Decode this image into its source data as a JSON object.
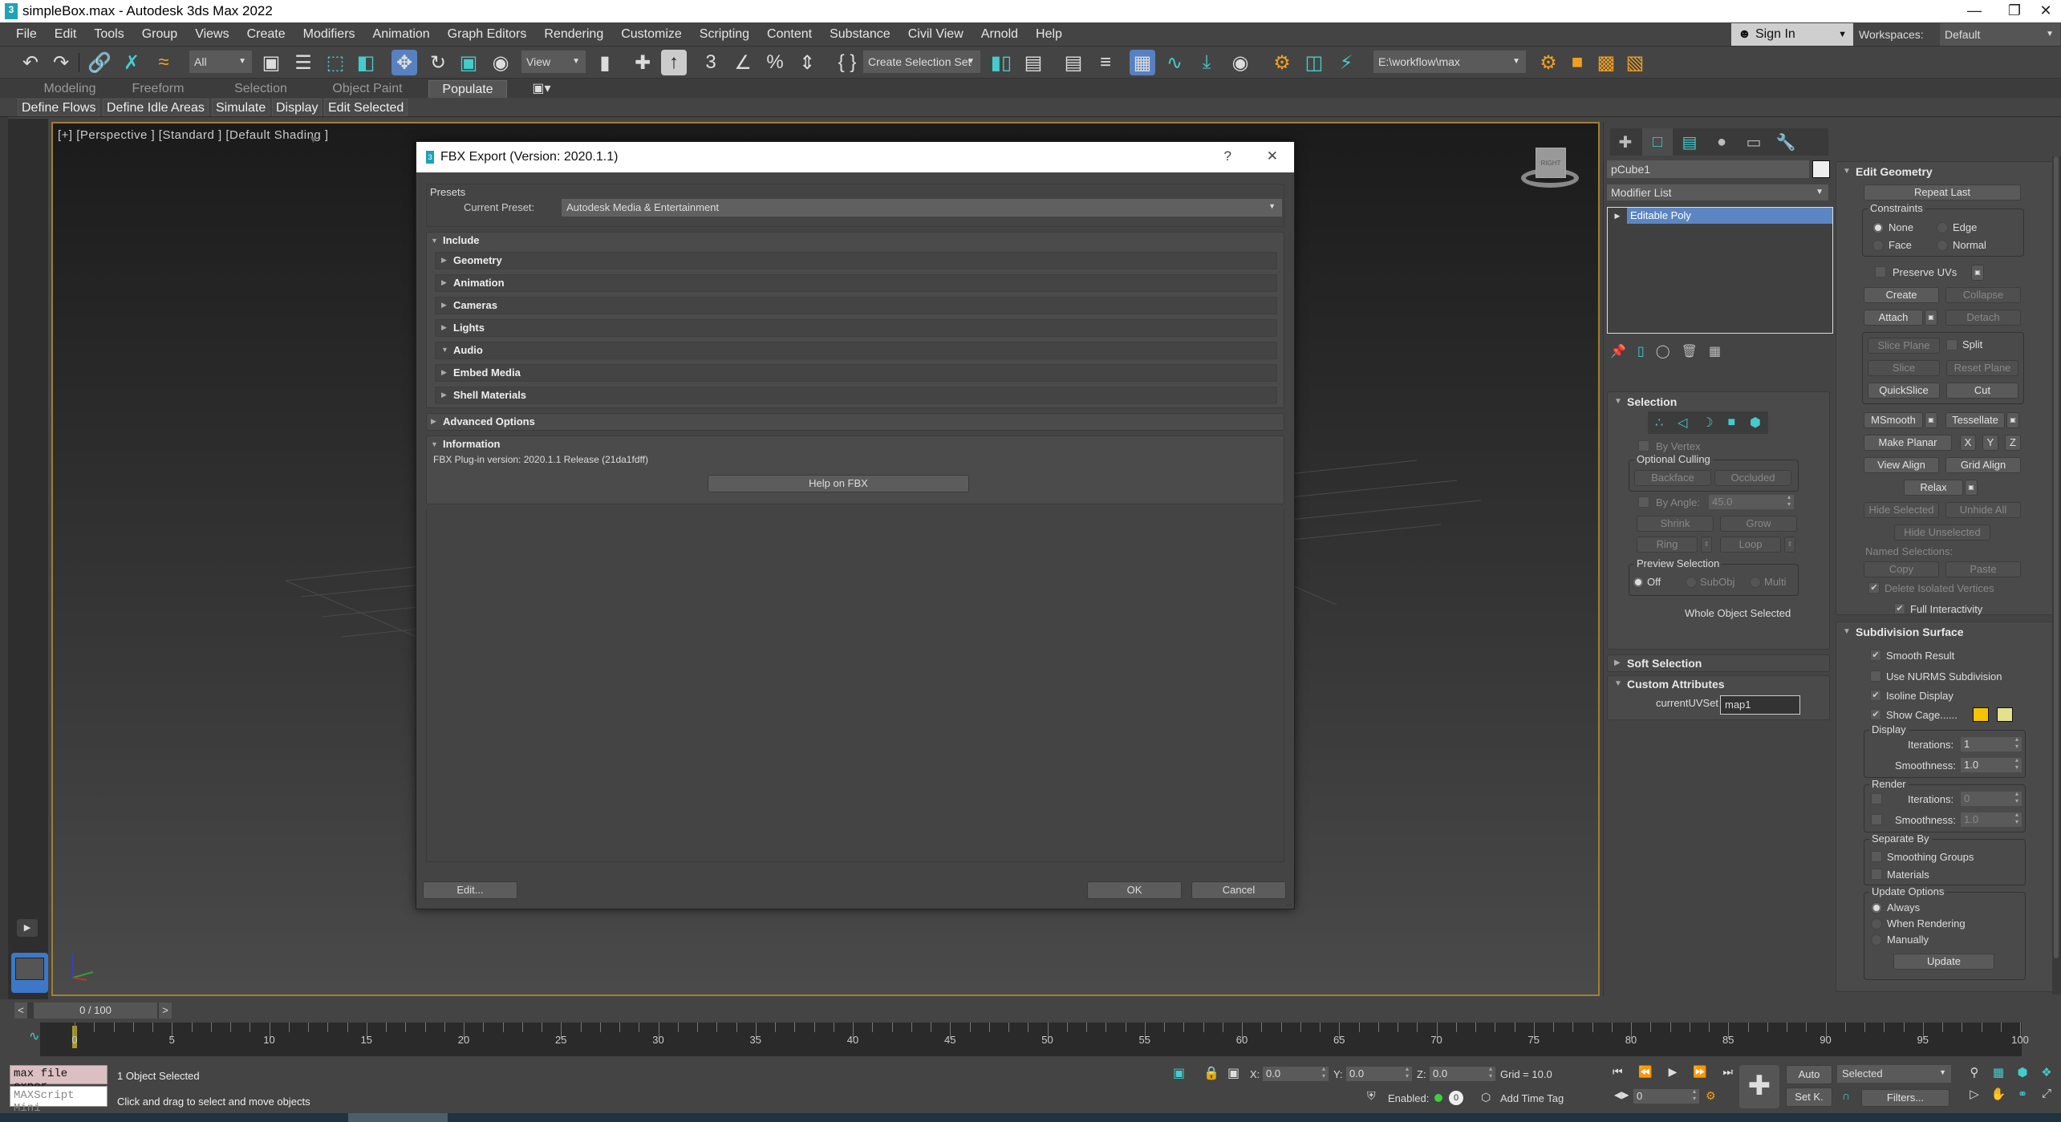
{
  "window": {
    "title": "simpleBox.max - Autodesk 3ds Max 2022",
    "app_icon": "3",
    "minimize": "—",
    "maximize": "❐",
    "close": "✕"
  },
  "menu": [
    "File",
    "Edit",
    "Tools",
    "Group",
    "Views",
    "Create",
    "Modifiers",
    "Animation",
    "Graph Editors",
    "Rendering",
    "Customize",
    "Scripting",
    "Content",
    "Substance",
    "Civil View",
    "Arnold",
    "Help"
  ],
  "account": {
    "sign_in": "Sign In",
    "workspaces_label": "Workspaces:",
    "workspace": "Default"
  },
  "toolbar": {
    "selection_filter": "All",
    "ref_coord": "View",
    "named_selection": "Create Selection Set",
    "project_path": "E:\\workflow\\max"
  },
  "ribbon": {
    "tabs": [
      "Modeling",
      "Freeform",
      "Selection",
      "Object Paint",
      "Populate"
    ],
    "active_tab": "Populate",
    "buttons": [
      "Define Flows",
      "Define Idle Areas",
      "Simulate",
      "Display",
      "Edit Selected"
    ]
  },
  "viewport": {
    "label": "[+] [Perspective ] [Standard ] [Default Shading ]",
    "viewcube_face": "RIGHT"
  },
  "dialog": {
    "title": "FBX Export (Version: 2020.1.1)",
    "help": "?",
    "close": "✕",
    "presets_label": "Presets",
    "current_preset_label": "Current Preset:",
    "current_preset": "Autodesk Media & Entertainment",
    "include_label": "Include",
    "include_items": [
      {
        "label": "Geometry",
        "expanded": false
      },
      {
        "label": "Animation",
        "expanded": false
      },
      {
        "label": "Cameras",
        "expanded": false
      },
      {
        "label": "Lights",
        "expanded": false
      },
      {
        "label": "Audio",
        "expanded": true
      },
      {
        "label": "Embed Media",
        "expanded": false
      },
      {
        "label": "Shell Materials",
        "expanded": false
      }
    ],
    "advanced_label": "Advanced Options",
    "information_label": "Information",
    "plugin_version": "FBX Plug-in version: 2020.1.1 Release (21da1fdff)",
    "help_button": "Help on FBX",
    "edit_button": "Edit...",
    "ok_button": "OK",
    "cancel_button": "Cancel"
  },
  "command_panel": {
    "object_name": "pCube1",
    "modifier_list": "Modifier List",
    "stack": [
      "Editable Poly"
    ],
    "selection": {
      "title": "Selection",
      "by_vertex": "By Vertex",
      "optional_culling": "Optional Culling",
      "backface": "Backface",
      "occluded": "Occluded",
      "by_angle": "By Angle:",
      "angle_value": "45.0",
      "shrink": "Shrink",
      "grow": "Grow",
      "ring": "Ring",
      "loop": "Loop",
      "preview_selection": "Preview Selection",
      "preview_off": "Off",
      "preview_subobj": "SubObj",
      "preview_multi": "Multi",
      "status": "Whole Object Selected"
    },
    "soft_selection": "Soft Selection",
    "custom_attributes": {
      "title": "Custom Attributes",
      "label": "currentUVSet",
      "value": "map1"
    },
    "edit_geometry": {
      "title": "Edit Geometry",
      "repeat_last": "Repeat Last",
      "constraints": "Constraints",
      "none": "None",
      "edge": "Edge",
      "face": "Face",
      "normal": "Normal",
      "preserve_uvs": "Preserve UVs",
      "create": "Create",
      "collapse": "Collapse",
      "attach": "Attach",
      "detach": "Detach",
      "slice_plane": "Slice Plane",
      "split": "Split",
      "slice": "Slice",
      "reset_plane": "Reset Plane",
      "quickslice": "QuickSlice",
      "cut": "Cut",
      "msmooth": "MSmooth",
      "tessellate": "Tessellate",
      "make_planar": "Make Planar",
      "x": "X",
      "y": "Y",
      "z": "Z",
      "view_align": "View Align",
      "grid_align": "Grid Align",
      "relax": "Relax",
      "hide_selected": "Hide Selected",
      "unhide_all": "Unhide All",
      "hide_unselected": "Hide Unselected",
      "named_selections": "Named Selections:",
      "copy": "Copy",
      "paste": "Paste",
      "delete_isolated": "Delete Isolated Vertices",
      "full_interactivity": "Full Interactivity"
    },
    "subdivision": {
      "title": "Subdivision Surface",
      "smooth_result": "Smooth Result",
      "use_nurms": "Use NURMS Subdivision",
      "isoline": "Isoline Display",
      "show_cage": "Show Cage......",
      "cage_color_1": "#f5c400",
      "cage_color_2": "#e3e08e",
      "display": "Display",
      "iterations_label": "Iterations:",
      "smoothness_label": "Smoothness:",
      "display_iterations": "1",
      "display_smoothness": "1.0",
      "render": "Render",
      "render_iterations": "0",
      "render_smoothness": "1.0",
      "separate_by": "Separate By",
      "smoothing_groups": "Smoothing Groups",
      "materials": "Materials",
      "update_options": "Update Options",
      "always": "Always",
      "when_rendering": "When Rendering",
      "manually": "Manually",
      "update": "Update"
    }
  },
  "timeline": {
    "slider": "0 / 100",
    "prev": "<",
    "next": ">",
    "ticks": [
      "0",
      "5",
      "10",
      "15",
      "20",
      "25",
      "30",
      "35",
      "40",
      "45",
      "50",
      "55",
      "60",
      "65",
      "70",
      "75",
      "80",
      "85",
      "90",
      "95",
      "100"
    ]
  },
  "status": {
    "script_listener": "max file expor",
    "mini_listener": "MAXScript Mini",
    "selected": "1 Object Selected",
    "prompt": "Click and drag to select and move objects",
    "x_label": "X:",
    "x": "0.0",
    "y_label": "Y:",
    "y": "0.0",
    "z_label": "Z:",
    "z": "0.0",
    "grid": "Grid = 10.0",
    "enabled": "Enabled:",
    "enabled_count": "0",
    "add_time_tag": "Add Time Tag",
    "frame": "0",
    "auto": "Auto",
    "set_key": "Set K.",
    "key_filter": "Selected",
    "filters": "Filters..."
  }
}
